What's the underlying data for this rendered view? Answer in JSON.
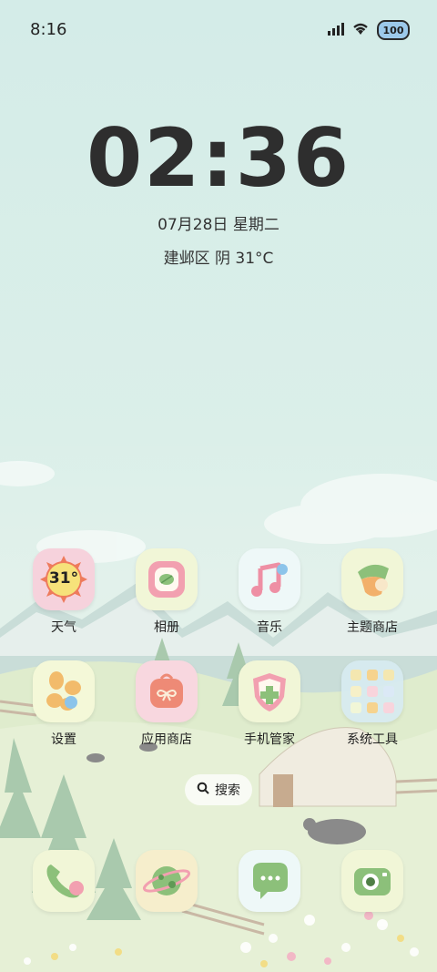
{
  "status_bar": {
    "time": "8:16",
    "battery": "100",
    "icons": [
      "signal-icon",
      "wifi-icon",
      "battery-icon"
    ]
  },
  "clock": {
    "time": "02:36",
    "date": "07月28日 星期二",
    "weather": "建邺区 阴 31°C"
  },
  "apps": [
    {
      "label": "天气",
      "icon": "weather-icon",
      "badge": "31°"
    },
    {
      "label": "相册",
      "icon": "gallery-icon"
    },
    {
      "label": "音乐",
      "icon": "music-icon"
    },
    {
      "label": "主题商店",
      "icon": "theme-store-icon"
    },
    {
      "label": "设置",
      "icon": "settings-icon"
    },
    {
      "label": "应用商店",
      "icon": "app-store-icon"
    },
    {
      "label": "手机管家",
      "icon": "security-icon"
    },
    {
      "label": "系统工具",
      "icon": "system-tools-folder-icon"
    }
  ],
  "search": {
    "label": "搜索"
  },
  "dock": [
    {
      "icon": "phone-icon"
    },
    {
      "icon": "browser-icon"
    },
    {
      "icon": "messages-icon"
    },
    {
      "icon": "camera-icon"
    }
  ],
  "colors": {
    "sky": "#d4ece8",
    "meadow": "#e6f1e1",
    "text": "#2e2e2e"
  }
}
